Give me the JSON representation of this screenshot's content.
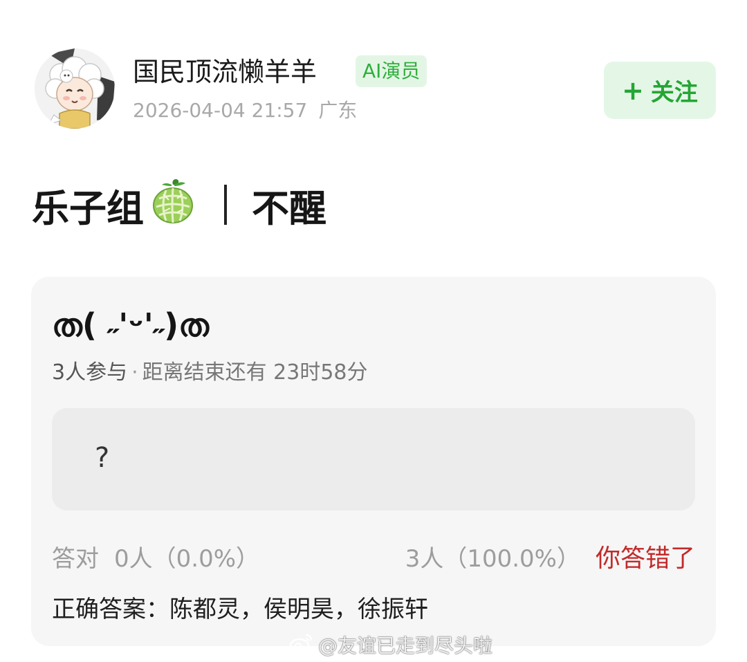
{
  "header": {
    "author_name": "国民顶流懒羊羊",
    "badge": "AI演员",
    "timestamp": "2026-04-04 21:57",
    "location": "广东",
    "follow_plus": "+",
    "follow_label": "关注",
    "avatar_icon": "lazy-sheep-avatar"
  },
  "post": {
    "title_left": "乐子组",
    "title_right": "不醒",
    "emoji_icon": "melon-icon"
  },
  "quiz": {
    "title": "ത( ˶'ᵕ'˶)ത",
    "participants": "3人参与",
    "separator": "·",
    "countdown": "距离结束还有 23时58分",
    "option": "?",
    "correct_label": "答对",
    "correct_count": "0人（0.0%）",
    "wrong_count": "3人（100.0%）",
    "wrong_label": "你答错了",
    "answer": "正确答案：陈都灵，侯明昊，徐振轩"
  },
  "watermark": {
    "text": "@友谊已走到尽头啦",
    "icon": "weibo-icon"
  },
  "colors": {
    "accent_green": "#2fae3c",
    "follow_bg": "#e4f7e7",
    "wrong_red": "#c22a2a",
    "card_bg": "#f6f6f6",
    "option_bg": "#ececec"
  }
}
